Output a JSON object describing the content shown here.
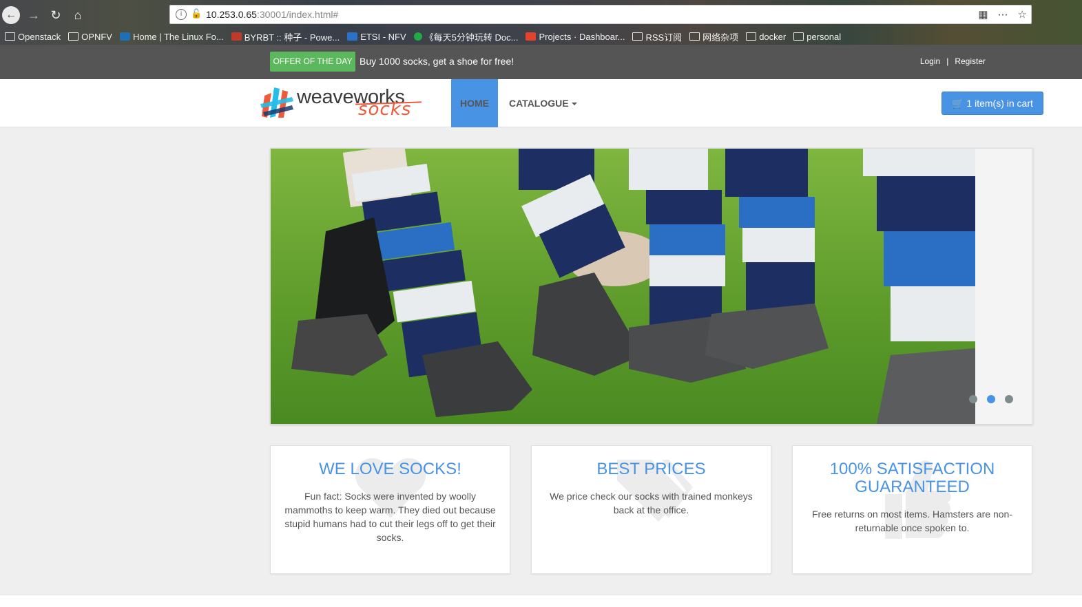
{
  "browser": {
    "url_host": "10.253.0.65",
    "url_rest": ":30001/index.html#",
    "bookmarks": [
      {
        "label": "Openstack",
        "icon": "folder-icon"
      },
      {
        "label": "OPNFV",
        "icon": "folder-icon"
      },
      {
        "label": "Home | The Linux Fo...",
        "icon": "linux-foundation-icon"
      },
      {
        "label": "BYRBT :: 种子 - Powe...",
        "icon": "byrbt-icon"
      },
      {
        "label": "ETSI - NFV",
        "icon": "etsi-icon"
      },
      {
        "label": "《每天5分钟玩转 Doc...",
        "icon": "green-dot-icon"
      },
      {
        "label": "Projects · Dashboar...",
        "icon": "gitlab-icon"
      },
      {
        "label": "RSS订阅",
        "icon": "folder-icon"
      },
      {
        "label": "网络杂项",
        "icon": "folder-icon"
      },
      {
        "label": "docker",
        "icon": "folder-icon"
      },
      {
        "label": "personal",
        "icon": "folder-icon"
      }
    ]
  },
  "topbar": {
    "offer_badge": "OFFER OF THE DAY",
    "offer_text": "Buy 1000 socks, get a shoe for free!",
    "login": "Login",
    "separator": "|",
    "register": "Register"
  },
  "navbar": {
    "logo_main": "weave",
    "logo_works": "works",
    "logo_sub": "socks",
    "home": "HOME",
    "catalogue": "CATALOGUE",
    "cart": "1 item(s) in cart"
  },
  "hero": {
    "slide_count": 3,
    "active_slide": 2
  },
  "features": [
    {
      "title": "WE LOVE SOCKS!",
      "text": "Fun fact: Socks were invented by woolly mammoths to keep warm. They died out because stupid humans had to cut their legs off to get their socks."
    },
    {
      "title": "BEST PRICES",
      "text": "We price check our socks with trained monkeys back at the office."
    },
    {
      "title": "100% SATISFACTION GUARANTEED",
      "text": "Free returns on most items. Hamsters are non-returnable once spoken to."
    }
  ],
  "colors": {
    "accent": "#4993e4",
    "offer": "#5cb85c",
    "topbar": "#555555",
    "logo_orange": "#ee5a3a"
  }
}
